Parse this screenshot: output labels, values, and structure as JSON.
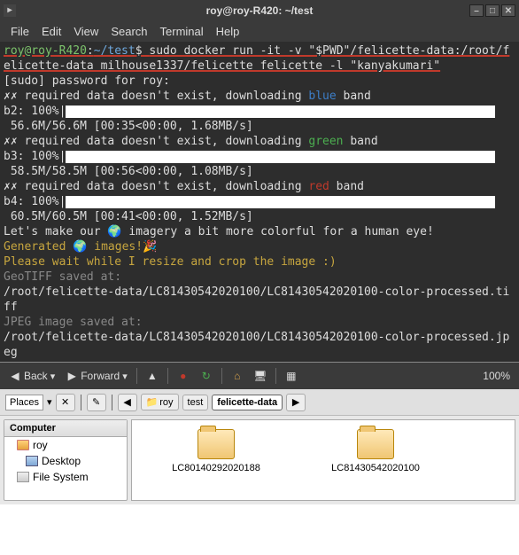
{
  "terminal": {
    "title": "roy@roy-R420: ~/test",
    "menu": [
      "File",
      "Edit",
      "View",
      "Search",
      "Terminal",
      "Help"
    ],
    "prompt_user": "roy@roy-R420",
    "prompt_path": "~/test",
    "prompt_sep": ":",
    "prompt_end": "$ ",
    "command": "sudo docker run -it -v \"$PWD\"/felicette-data:/root/felicette-data milhouse1337/felicette felicette -l \"kanyakumari\"",
    "sudo_line": "[sudo] password for roy:",
    "dl_prefix": "✗ required data doesn't exist, downloading ",
    "dl_suffix": " band",
    "bands": {
      "blue": {
        "name": "blue",
        "label": "b2: 100%|",
        "stats": " 56.6M/56.6M [00:35<00:00, 1.68MB/s]"
      },
      "green": {
        "name": "green",
        "label": "b3: 100%|",
        "stats": " 58.5M/58.5M [00:56<00:00, 1.08MB/s]"
      },
      "red": {
        "name": "red",
        "label": "b4: 100%|",
        "stats": " 60.5M/60.5M [00:41<00:00, 1.52MB/s]"
      }
    },
    "colorful_line": "Let's make our 🌍 imagery a bit more colorful for a human eye!",
    "generated_line": "Generated 🌍 images!🎉",
    "please_wait": "Please wait while I resize and crop the image :)",
    "geotiff_saved": "GeoTIFF saved at:",
    "tiff_path": "/root/felicette-data/LC81430542020100/LC81430542020100-color-processed.tiff",
    "jpeg_saved": "JPEG image saved at:",
    "jpeg_path": "/root/felicette-data/LC81430542020100/LC81430542020100-color-processed.jpeg"
  },
  "filemanager": {
    "back": "Back",
    "forward": "Forward",
    "zoom": "100%",
    "places_label": "Places",
    "breadcrumb": {
      "home": "roy",
      "folder1": "test",
      "folder2": "felicette-data"
    },
    "sidebar": {
      "head": "Computer",
      "roy": "roy",
      "desktop": "Desktop",
      "filesystem": "File System"
    },
    "items": {
      "f1": "LC80140292020188",
      "f2": "LC81430542020100"
    }
  }
}
